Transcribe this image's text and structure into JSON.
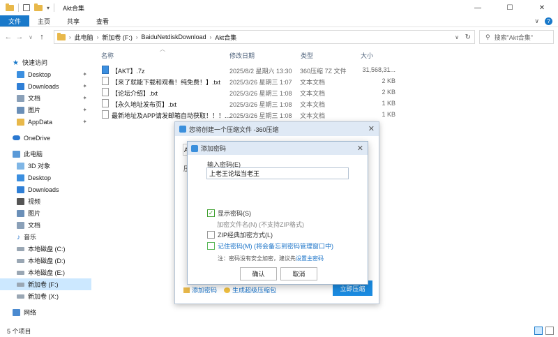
{
  "window": {
    "title": "Akt合集",
    "controls": [
      "—",
      "☐",
      "✕"
    ]
  },
  "ribbon": {
    "tabs": [
      "文件",
      "主页",
      "共享",
      "查看"
    ],
    "right_chevron": "∨",
    "help": "?"
  },
  "nav": {
    "back": "←",
    "forward": "→",
    "recent": "∨",
    "up": "↑"
  },
  "address": {
    "crumbs": [
      "此电脑",
      "新加卷 (F:)",
      "BaiduNetdiskDownload",
      "Akt合集"
    ],
    "separator": "›"
  },
  "search": {
    "placeholder": "搜索\"Akt合集\"",
    "icon": "search-icon"
  },
  "columns": {
    "name": "名称",
    "date": "修改日期",
    "type": "类型",
    "size": "大小"
  },
  "files": [
    {
      "name": "【AKT】.7z",
      "date": "2025/8/2 星期六 13:30",
      "type": "360压缩 7Z 文件",
      "size": "31,568,31...",
      "icon": "archive"
    },
    {
      "name": "【来了就能下载和观看！纯免费！】.txt",
      "date": "2025/3/26 星期三 1:07",
      "type": "文本文档",
      "size": "2 KB",
      "icon": "text"
    },
    {
      "name": "【论坛介绍】.txt",
      "date": "2025/3/26 星期三 1:08",
      "type": "文本文档",
      "size": "2 KB",
      "icon": "text"
    },
    {
      "name": "【永久地址发布页】.txt",
      "date": "2025/3/26 星期三 1:08",
      "type": "文本文档",
      "size": "1 KB",
      "icon": "text"
    },
    {
      "name": "最新地址及APP请发邮箱自动获取！！！...",
      "date": "2025/3/26 星期三 1:08",
      "type": "文本文档",
      "size": "1 KB",
      "icon": "text"
    }
  ],
  "sidebar": {
    "quick_access": "快速访问",
    "quick_items": [
      "Desktop",
      "Downloads",
      "文档",
      "图片",
      "AppData"
    ],
    "onedrive": "OneDrive",
    "this_pc": "此电脑",
    "pc_items": [
      "3D 对象",
      "Desktop",
      "Downloads",
      "视频",
      "图片",
      "文档",
      "音乐",
      "本地磁盘 (C:)",
      "本地磁盘 (D:)",
      "本地磁盘 (E:)",
      "新加卷 (F:)",
      "新加卷 (X:)"
    ],
    "network": "网络",
    "pin": "📌"
  },
  "status": {
    "count": "5 个项目"
  },
  "dialog_360": {
    "title": "您将创建一个压缩文件 -360压缩",
    "stub_a": "A",
    "stub_z": "压",
    "add_password": "添加密码",
    "make_sfx": "生成超级压缩包",
    "go": "立即压缩",
    "close": "✕"
  },
  "dialog_password": {
    "title": "添加密码",
    "close": "✕",
    "label": "输入密码(E)",
    "value": "上老王论坛当老王",
    "show_password": "显示密码(S)",
    "encrypt_names": "加密文件名(N) (不支持ZIP格式)",
    "zip_classic": "ZIP经典加密方式(L)",
    "remember": "记住密码(M) (将会备忘到密码管理窗口中)",
    "note": "注：密码没有安全加密，建议先",
    "note_link": "设置主密码",
    "ok": "确认",
    "cancel": "取消",
    "checkmark": "✓"
  },
  "colors": {
    "accent": "#1979ca",
    "selected": "#cce8ff",
    "link": "#1a73c8",
    "primary_button": "#1b8be0"
  }
}
